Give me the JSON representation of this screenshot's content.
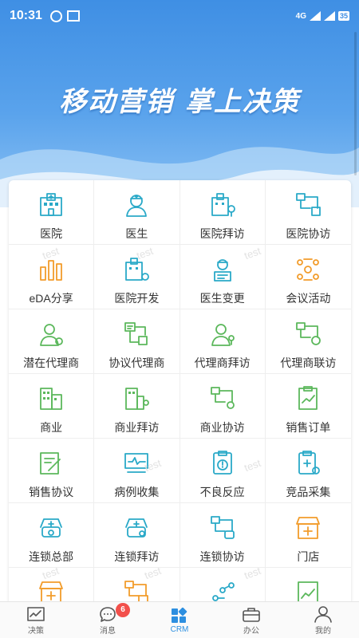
{
  "status_bar": {
    "time": "10:31",
    "network": "4G",
    "battery": "35"
  },
  "hero": {
    "slogan": "移动营销  掌上决策"
  },
  "watermark": "test",
  "grid": [
    {
      "label": "医院",
      "icon": "hospital-icon",
      "color": "#2aa9c8"
    },
    {
      "label": "医生",
      "icon": "doctor-icon",
      "color": "#2aa9c8"
    },
    {
      "label": "医院拜访",
      "icon": "hospital-visit-icon",
      "color": "#2aa9c8"
    },
    {
      "label": "医院协访",
      "icon": "hospital-assist-icon",
      "color": "#2aa9c8"
    },
    {
      "label": "eDA分享",
      "icon": "eda-share-icon",
      "color": "#f29c2b"
    },
    {
      "label": "医院开发",
      "icon": "hospital-develop-icon",
      "color": "#2aa9c8"
    },
    {
      "label": "医生变更",
      "icon": "doctor-change-icon",
      "color": "#2aa9c8"
    },
    {
      "label": "会议活动",
      "icon": "meeting-icon",
      "color": "#f29c2b"
    },
    {
      "label": "潜在代理商",
      "icon": "potential-agent-icon",
      "color": "#5cb85c"
    },
    {
      "label": "协议代理商",
      "icon": "contract-agent-icon",
      "color": "#5cb85c"
    },
    {
      "label": "代理商拜访",
      "icon": "agent-visit-icon",
      "color": "#5cb85c"
    },
    {
      "label": "代理商联访",
      "icon": "agent-joint-visit-icon",
      "color": "#5cb85c"
    },
    {
      "label": "商业",
      "icon": "commerce-icon",
      "color": "#5cb85c"
    },
    {
      "label": "商业拜访",
      "icon": "commerce-visit-icon",
      "color": "#5cb85c"
    },
    {
      "label": "商业协访",
      "icon": "commerce-assist-icon",
      "color": "#5cb85c"
    },
    {
      "label": "销售订单",
      "icon": "sales-order-icon",
      "color": "#5cb85c"
    },
    {
      "label": "销售协议",
      "icon": "sales-agreement-icon",
      "color": "#5cb85c"
    },
    {
      "label": "病例收集",
      "icon": "case-collect-icon",
      "color": "#2aa9c8"
    },
    {
      "label": "不良反应",
      "icon": "adverse-reaction-icon",
      "color": "#2aa9c8"
    },
    {
      "label": "竞品采集",
      "icon": "competitor-collect-icon",
      "color": "#2aa9c8"
    },
    {
      "label": "连锁总部",
      "icon": "chain-hq-icon",
      "color": "#2aa9c8"
    },
    {
      "label": "连锁拜访",
      "icon": "chain-visit-icon",
      "color": "#2aa9c8"
    },
    {
      "label": "连锁协访",
      "icon": "chain-assist-icon",
      "color": "#2aa9c8"
    },
    {
      "label": "门店",
      "icon": "store-icon",
      "color": "#f29c2b"
    },
    {
      "label": "",
      "icon": "store-add-icon",
      "color": "#f29c2b"
    },
    {
      "label": "",
      "icon": "store-visit-icon",
      "color": "#f29c2b"
    },
    {
      "label": "",
      "icon": "flow-icon",
      "color": "#2aa9c8"
    },
    {
      "label": "",
      "icon": "sales-chart-icon",
      "color": "#5cb85c"
    }
  ],
  "tabs": [
    {
      "label": "决策",
      "icon": "chart-icon"
    },
    {
      "label": "消息",
      "icon": "message-icon",
      "badge": "6"
    },
    {
      "label": "CRM",
      "icon": "crm-icon",
      "active": true
    },
    {
      "label": "办公",
      "icon": "briefcase-icon"
    },
    {
      "label": "我的",
      "icon": "person-icon"
    }
  ],
  "colors": {
    "accent": "#2d8fe0",
    "hero": "#3f8fe4",
    "badge": "#f2504b"
  }
}
